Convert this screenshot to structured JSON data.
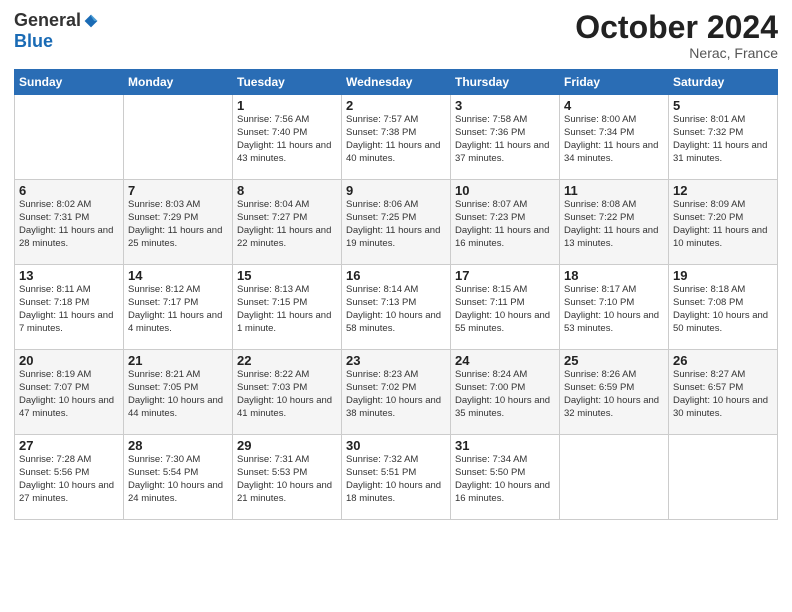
{
  "logo": {
    "general": "General",
    "blue": "Blue"
  },
  "title": "October 2024",
  "subtitle": "Nerac, France",
  "days_of_week": [
    "Sunday",
    "Monday",
    "Tuesday",
    "Wednesday",
    "Thursday",
    "Friday",
    "Saturday"
  ],
  "weeks": [
    [
      {
        "day": "",
        "sunrise": "",
        "sunset": "",
        "daylight": ""
      },
      {
        "day": "",
        "sunrise": "",
        "sunset": "",
        "daylight": ""
      },
      {
        "day": "1",
        "sunrise": "Sunrise: 7:56 AM",
        "sunset": "Sunset: 7:40 PM",
        "daylight": "Daylight: 11 hours and 43 minutes."
      },
      {
        "day": "2",
        "sunrise": "Sunrise: 7:57 AM",
        "sunset": "Sunset: 7:38 PM",
        "daylight": "Daylight: 11 hours and 40 minutes."
      },
      {
        "day": "3",
        "sunrise": "Sunrise: 7:58 AM",
        "sunset": "Sunset: 7:36 PM",
        "daylight": "Daylight: 11 hours and 37 minutes."
      },
      {
        "day": "4",
        "sunrise": "Sunrise: 8:00 AM",
        "sunset": "Sunset: 7:34 PM",
        "daylight": "Daylight: 11 hours and 34 minutes."
      },
      {
        "day": "5",
        "sunrise": "Sunrise: 8:01 AM",
        "sunset": "Sunset: 7:32 PM",
        "daylight": "Daylight: 11 hours and 31 minutes."
      }
    ],
    [
      {
        "day": "6",
        "sunrise": "Sunrise: 8:02 AM",
        "sunset": "Sunset: 7:31 PM",
        "daylight": "Daylight: 11 hours and 28 minutes."
      },
      {
        "day": "7",
        "sunrise": "Sunrise: 8:03 AM",
        "sunset": "Sunset: 7:29 PM",
        "daylight": "Daylight: 11 hours and 25 minutes."
      },
      {
        "day": "8",
        "sunrise": "Sunrise: 8:04 AM",
        "sunset": "Sunset: 7:27 PM",
        "daylight": "Daylight: 11 hours and 22 minutes."
      },
      {
        "day": "9",
        "sunrise": "Sunrise: 8:06 AM",
        "sunset": "Sunset: 7:25 PM",
        "daylight": "Daylight: 11 hours and 19 minutes."
      },
      {
        "day": "10",
        "sunrise": "Sunrise: 8:07 AM",
        "sunset": "Sunset: 7:23 PM",
        "daylight": "Daylight: 11 hours and 16 minutes."
      },
      {
        "day": "11",
        "sunrise": "Sunrise: 8:08 AM",
        "sunset": "Sunset: 7:22 PM",
        "daylight": "Daylight: 11 hours and 13 minutes."
      },
      {
        "day": "12",
        "sunrise": "Sunrise: 8:09 AM",
        "sunset": "Sunset: 7:20 PM",
        "daylight": "Daylight: 11 hours and 10 minutes."
      }
    ],
    [
      {
        "day": "13",
        "sunrise": "Sunrise: 8:11 AM",
        "sunset": "Sunset: 7:18 PM",
        "daylight": "Daylight: 11 hours and 7 minutes."
      },
      {
        "day": "14",
        "sunrise": "Sunrise: 8:12 AM",
        "sunset": "Sunset: 7:17 PM",
        "daylight": "Daylight: 11 hours and 4 minutes."
      },
      {
        "day": "15",
        "sunrise": "Sunrise: 8:13 AM",
        "sunset": "Sunset: 7:15 PM",
        "daylight": "Daylight: 11 hours and 1 minute."
      },
      {
        "day": "16",
        "sunrise": "Sunrise: 8:14 AM",
        "sunset": "Sunset: 7:13 PM",
        "daylight": "Daylight: 10 hours and 58 minutes."
      },
      {
        "day": "17",
        "sunrise": "Sunrise: 8:15 AM",
        "sunset": "Sunset: 7:11 PM",
        "daylight": "Daylight: 10 hours and 55 minutes."
      },
      {
        "day": "18",
        "sunrise": "Sunrise: 8:17 AM",
        "sunset": "Sunset: 7:10 PM",
        "daylight": "Daylight: 10 hours and 53 minutes."
      },
      {
        "day": "19",
        "sunrise": "Sunrise: 8:18 AM",
        "sunset": "Sunset: 7:08 PM",
        "daylight": "Daylight: 10 hours and 50 minutes."
      }
    ],
    [
      {
        "day": "20",
        "sunrise": "Sunrise: 8:19 AM",
        "sunset": "Sunset: 7:07 PM",
        "daylight": "Daylight: 10 hours and 47 minutes."
      },
      {
        "day": "21",
        "sunrise": "Sunrise: 8:21 AM",
        "sunset": "Sunset: 7:05 PM",
        "daylight": "Daylight: 10 hours and 44 minutes."
      },
      {
        "day": "22",
        "sunrise": "Sunrise: 8:22 AM",
        "sunset": "Sunset: 7:03 PM",
        "daylight": "Daylight: 10 hours and 41 minutes."
      },
      {
        "day": "23",
        "sunrise": "Sunrise: 8:23 AM",
        "sunset": "Sunset: 7:02 PM",
        "daylight": "Daylight: 10 hours and 38 minutes."
      },
      {
        "day": "24",
        "sunrise": "Sunrise: 8:24 AM",
        "sunset": "Sunset: 7:00 PM",
        "daylight": "Daylight: 10 hours and 35 minutes."
      },
      {
        "day": "25",
        "sunrise": "Sunrise: 8:26 AM",
        "sunset": "Sunset: 6:59 PM",
        "daylight": "Daylight: 10 hours and 32 minutes."
      },
      {
        "day": "26",
        "sunrise": "Sunrise: 8:27 AM",
        "sunset": "Sunset: 6:57 PM",
        "daylight": "Daylight: 10 hours and 30 minutes."
      }
    ],
    [
      {
        "day": "27",
        "sunrise": "Sunrise: 7:28 AM",
        "sunset": "Sunset: 5:56 PM",
        "daylight": "Daylight: 10 hours and 27 minutes."
      },
      {
        "day": "28",
        "sunrise": "Sunrise: 7:30 AM",
        "sunset": "Sunset: 5:54 PM",
        "daylight": "Daylight: 10 hours and 24 minutes."
      },
      {
        "day": "29",
        "sunrise": "Sunrise: 7:31 AM",
        "sunset": "Sunset: 5:53 PM",
        "daylight": "Daylight: 10 hours and 21 minutes."
      },
      {
        "day": "30",
        "sunrise": "Sunrise: 7:32 AM",
        "sunset": "Sunset: 5:51 PM",
        "daylight": "Daylight: 10 hours and 18 minutes."
      },
      {
        "day": "31",
        "sunrise": "Sunrise: 7:34 AM",
        "sunset": "Sunset: 5:50 PM",
        "daylight": "Daylight: 10 hours and 16 minutes."
      },
      {
        "day": "",
        "sunrise": "",
        "sunset": "",
        "daylight": ""
      },
      {
        "day": "",
        "sunrise": "",
        "sunset": "",
        "daylight": ""
      }
    ]
  ]
}
